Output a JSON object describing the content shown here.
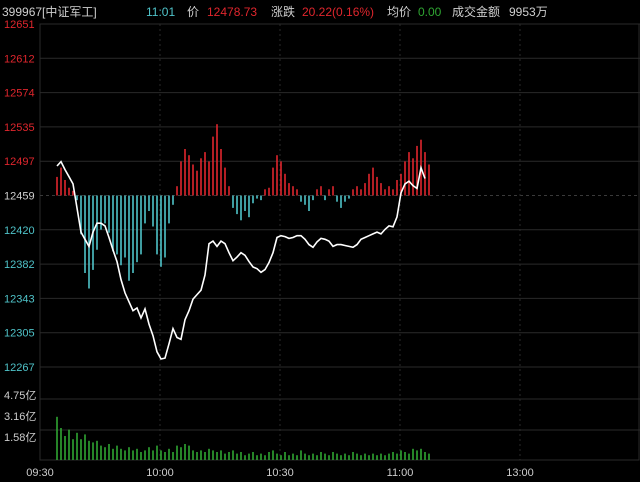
{
  "header": {
    "code_name": "399967[中证军工]",
    "time": "11:01",
    "price_label": "价",
    "price": "12478.73",
    "change_label": "涨跌",
    "change": "20.22(0.16%)",
    "avg_label": "均价",
    "avg": "0.00",
    "amount_label": "成交金额",
    "amount": "9953万"
  },
  "colors": {
    "bg": "#000000",
    "grid": "#2a2a2a",
    "grid_dash": "#3a3a3a",
    "up": "#e0262d",
    "down": "#4fc3c9",
    "line": "#ffffff",
    "volume": "#2fa532",
    "axis_text_up": "#e0262d",
    "axis_text_base": "#cfcfcf",
    "axis_text_neutral": "#cccccc",
    "header_label": "#cfcfcf",
    "header_time": "#4fc3c9",
    "header_change": "#e0262d",
    "header_avg": "#2fa532"
  },
  "chart_data": {
    "type": "line",
    "base_price": 12459,
    "y_ticks": [
      "12651",
      "12612",
      "12574",
      "12535",
      "12497",
      "12459",
      "12420",
      "12382",
      "12343",
      "12305",
      "12267"
    ],
    "volume_ticks": [
      "4.75亿",
      "3.16亿",
      "1.58亿"
    ],
    "x_ticks": [
      "09:30",
      "10:00",
      "10:30",
      "11:00",
      "13:00"
    ],
    "ylim": [
      12267,
      12651
    ],
    "x_range_minutes": 150,
    "price": [
      [
        0,
        12492
      ],
      [
        1,
        12497
      ],
      [
        2,
        12488
      ],
      [
        3,
        12480
      ],
      [
        4,
        12472
      ],
      [
        5,
        12445
      ],
      [
        6,
        12418
      ],
      [
        7,
        12410
      ],
      [
        8,
        12402
      ],
      [
        9,
        12418
      ],
      [
        10,
        12428
      ],
      [
        11,
        12428
      ],
      [
        12,
        12425
      ],
      [
        13,
        12412
      ],
      [
        14,
        12398
      ],
      [
        15,
        12385
      ],
      [
        16,
        12365
      ],
      [
        17,
        12350
      ],
      [
        18,
        12340
      ],
      [
        19,
        12330
      ],
      [
        20,
        12333
      ],
      [
        21,
        12322
      ],
      [
        22,
        12332
      ],
      [
        23,
        12315
      ],
      [
        24,
        12302
      ],
      [
        25,
        12284
      ],
      [
        26,
        12276
      ],
      [
        27,
        12277
      ],
      [
        28,
        12293
      ],
      [
        29,
        12310
      ],
      [
        30,
        12300
      ],
      [
        31,
        12298
      ],
      [
        32,
        12320
      ],
      [
        33,
        12330
      ],
      [
        34,
        12343
      ],
      [
        35,
        12348
      ],
      [
        36,
        12353
      ],
      [
        37,
        12370
      ],
      [
        38,
        12405
      ],
      [
        39,
        12408
      ],
      [
        40,
        12402
      ],
      [
        41,
        12408
      ],
      [
        42,
        12405
      ],
      [
        43,
        12395
      ],
      [
        44,
        12386
      ],
      [
        45,
        12390
      ],
      [
        46,
        12395
      ],
      [
        47,
        12392
      ],
      [
        48,
        12385
      ],
      [
        49,
        12379
      ],
      [
        50,
        12377
      ],
      [
        51,
        12373
      ],
      [
        52,
        12376
      ],
      [
        53,
        12384
      ],
      [
        54,
        12395
      ],
      [
        55,
        12412
      ],
      [
        56,
        12414
      ],
      [
        57,
        12413
      ],
      [
        58,
        12411
      ],
      [
        59,
        12412
      ],
      [
        60,
        12414
      ],
      [
        61,
        12414
      ],
      [
        62,
        12410
      ],
      [
        63,
        12404
      ],
      [
        64,
        12401
      ],
      [
        65,
        12407
      ],
      [
        66,
        12411
      ],
      [
        67,
        12410
      ],
      [
        68,
        12408
      ],
      [
        69,
        12402
      ],
      [
        70,
        12404
      ],
      [
        71,
        12404
      ],
      [
        72,
        12403
      ],
      [
        73,
        12402
      ],
      [
        74,
        12401
      ],
      [
        75,
        12404
      ],
      [
        76,
        12410
      ],
      [
        77,
        12412
      ],
      [
        78,
        12414
      ],
      [
        79,
        12416
      ],
      [
        80,
        12418
      ],
      [
        81,
        12416
      ],
      [
        82,
        12421
      ],
      [
        83,
        12425
      ],
      [
        84,
        12424
      ],
      [
        85,
        12435
      ],
      [
        86,
        12462
      ],
      [
        87,
        12472
      ],
      [
        88,
        12475
      ],
      [
        89,
        12470
      ],
      [
        90,
        12467
      ],
      [
        91,
        12490
      ],
      [
        92,
        12478
      ]
    ],
    "diff": [
      [
        0,
        12
      ],
      [
        1,
        18
      ],
      [
        2,
        10
      ],
      [
        3,
        5
      ],
      [
        4,
        3
      ],
      [
        5,
        -3
      ],
      [
        6,
        -25
      ],
      [
        7,
        -50
      ],
      [
        8,
        -60
      ],
      [
        9,
        -48
      ],
      [
        10,
        -35
      ],
      [
        11,
        -22
      ],
      [
        12,
        -18
      ],
      [
        13,
        -24
      ],
      [
        14,
        -36
      ],
      [
        15,
        -38
      ],
      [
        16,
        -45
      ],
      [
        17,
        -40
      ],
      [
        18,
        -55
      ],
      [
        19,
        -50
      ],
      [
        20,
        -43
      ],
      [
        21,
        -38
      ],
      [
        22,
        -18
      ],
      [
        23,
        -10
      ],
      [
        24,
        -20
      ],
      [
        25,
        -38
      ],
      [
        26,
        -46
      ],
      [
        27,
        -40
      ],
      [
        28,
        -18
      ],
      [
        29,
        -6
      ],
      [
        30,
        6
      ],
      [
        31,
        22
      ],
      [
        32,
        30
      ],
      [
        33,
        26
      ],
      [
        34,
        20
      ],
      [
        35,
        16
      ],
      [
        36,
        24
      ],
      [
        37,
        28
      ],
      [
        38,
        22
      ],
      [
        39,
        38
      ],
      [
        40,
        46
      ],
      [
        41,
        30
      ],
      [
        42,
        18
      ],
      [
        43,
        6
      ],
      [
        44,
        -8
      ],
      [
        45,
        -12
      ],
      [
        46,
        -16
      ],
      [
        47,
        -10
      ],
      [
        48,
        -14
      ],
      [
        49,
        -5
      ],
      [
        50,
        -2
      ],
      [
        51,
        -3
      ],
      [
        52,
        4
      ],
      [
        53,
        5
      ],
      [
        54,
        18
      ],
      [
        55,
        26
      ],
      [
        56,
        22
      ],
      [
        57,
        14
      ],
      [
        58,
        8
      ],
      [
        59,
        6
      ],
      [
        60,
        4
      ],
      [
        61,
        -4
      ],
      [
        62,
        -6
      ],
      [
        63,
        -10
      ],
      [
        64,
        -3
      ],
      [
        65,
        4
      ],
      [
        66,
        6
      ],
      [
        67,
        -3
      ],
      [
        68,
        4
      ],
      [
        69,
        6
      ],
      [
        70,
        -4
      ],
      [
        71,
        -8
      ],
      [
        72,
        -4
      ],
      [
        73,
        -2
      ],
      [
        74,
        4
      ],
      [
        75,
        6
      ],
      [
        76,
        4
      ],
      [
        77,
        8
      ],
      [
        78,
        14
      ],
      [
        79,
        18
      ],
      [
        80,
        12
      ],
      [
        81,
        8
      ],
      [
        82,
        4
      ],
      [
        83,
        6
      ],
      [
        84,
        4
      ],
      [
        85,
        10
      ],
      [
        86,
        14
      ],
      [
        87,
        22
      ],
      [
        88,
        28
      ],
      [
        89,
        24
      ],
      [
        90,
        32
      ],
      [
        91,
        36
      ],
      [
        92,
        28
      ],
      [
        93,
        20
      ]
    ],
    "volume": [
      [
        0,
        2.7
      ],
      [
        1,
        2.0
      ],
      [
        2,
        1.5
      ],
      [
        3,
        1.9
      ],
      [
        4,
        1.3
      ],
      [
        5,
        1.7
      ],
      [
        6,
        1.3
      ],
      [
        7,
        1.6
      ],
      [
        8,
        1.2
      ],
      [
        9,
        1.1
      ],
      [
        10,
        1.2
      ],
      [
        11,
        0.9
      ],
      [
        12,
        0.8
      ],
      [
        13,
        1.0
      ],
      [
        14,
        0.7
      ],
      [
        15,
        0.9
      ],
      [
        16,
        0.7
      ],
      [
        17,
        0.6
      ],
      [
        18,
        0.8
      ],
      [
        19,
        0.6
      ],
      [
        20,
        0.7
      ],
      [
        21,
        0.5
      ],
      [
        22,
        0.6
      ],
      [
        23,
        0.8
      ],
      [
        24,
        0.6
      ],
      [
        25,
        0.9
      ],
      [
        26,
        0.6
      ],
      [
        27,
        0.5
      ],
      [
        28,
        0.7
      ],
      [
        29,
        0.5
      ],
      [
        30,
        0.9
      ],
      [
        31,
        0.8
      ],
      [
        32,
        1.0
      ],
      [
        33,
        0.9
      ],
      [
        34,
        0.6
      ],
      [
        35,
        0.5
      ],
      [
        36,
        0.6
      ],
      [
        37,
        0.5
      ],
      [
        38,
        0.7
      ],
      [
        39,
        0.6
      ],
      [
        40,
        0.5
      ],
      [
        41,
        0.6
      ],
      [
        42,
        0.4
      ],
      [
        43,
        0.5
      ],
      [
        44,
        0.6
      ],
      [
        45,
        0.4
      ],
      [
        46,
        0.5
      ],
      [
        47,
        0.3
      ],
      [
        48,
        0.4
      ],
      [
        49,
        0.5
      ],
      [
        50,
        0.3
      ],
      [
        51,
        0.4
      ],
      [
        52,
        0.3
      ],
      [
        53,
        0.5
      ],
      [
        54,
        0.6
      ],
      [
        55,
        0.4
      ],
      [
        56,
        0.3
      ],
      [
        57,
        0.5
      ],
      [
        58,
        0.3
      ],
      [
        59,
        0.4
      ],
      [
        60,
        0.3
      ],
      [
        61,
        0.6
      ],
      [
        62,
        0.4
      ],
      [
        63,
        0.3
      ],
      [
        64,
        0.4
      ],
      [
        65,
        0.3
      ],
      [
        66,
        0.5
      ],
      [
        67,
        0.4
      ],
      [
        68,
        0.3
      ],
      [
        69,
        0.5
      ],
      [
        70,
        0.4
      ],
      [
        71,
        0.3
      ],
      [
        72,
        0.4
      ],
      [
        73,
        0.3
      ],
      [
        74,
        0.5
      ],
      [
        75,
        0.4
      ],
      [
        76,
        0.3
      ],
      [
        77,
        0.4
      ],
      [
        78,
        0.3
      ],
      [
        79,
        0.4
      ],
      [
        80,
        0.3
      ],
      [
        81,
        0.4
      ],
      [
        82,
        0.3
      ],
      [
        83,
        0.4
      ],
      [
        84,
        0.5
      ],
      [
        85,
        0.4
      ],
      [
        86,
        0.6
      ],
      [
        87,
        0.5
      ],
      [
        88,
        0.4
      ],
      [
        89,
        0.7
      ],
      [
        90,
        0.6
      ],
      [
        91,
        0.7
      ],
      [
        92,
        0.5
      ],
      [
        93,
        0.4
      ]
    ]
  }
}
